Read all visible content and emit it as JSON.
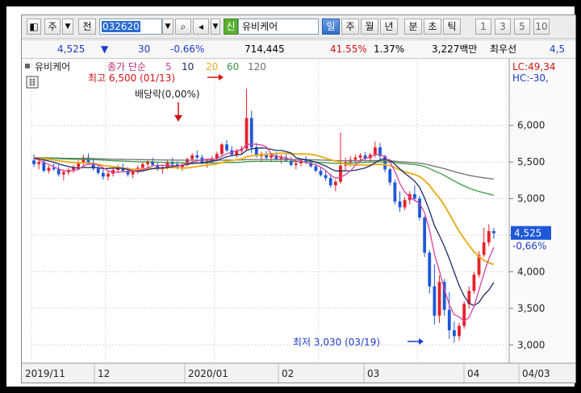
{
  "toolbar": {
    "btn_stock": "주",
    "btn_prev": "전",
    "code": "032620",
    "badge_new": "신",
    "stock_name": "유비케어",
    "periods": [
      "일",
      "주",
      "월",
      "년",
      "분",
      "초",
      "틱"
    ],
    "selected_period": "일",
    "intervals": [
      "1",
      "3",
      "5",
      "10"
    ]
  },
  "info": {
    "price": "4,525",
    "change": "30",
    "change_pct": "-0.66%",
    "volume": "714,445",
    "pct1": "41.55%",
    "pct2": "1.37%",
    "amount": "3,227백만",
    "pref_label": "최우선",
    "pref_value": "4,5"
  },
  "legend": {
    "name": "유비케어",
    "series_label": "종가 단순",
    "ma": [
      "5",
      "10",
      "20",
      "60",
      "120"
    ]
  },
  "colors": {
    "ma5": "#d8409e",
    "ma10": "#1e2a66",
    "ma20": "#e8b020",
    "ma60": "#3a9a44",
    "ma120": "#707070",
    "up": "#e8202a",
    "down": "#1e58d8"
  },
  "annotations": {
    "high": "최고 6,500 (01/13)",
    "dividend": "배당락(0,00%)",
    "low": "최저 3,030 (03/19)",
    "lc": "LC:49,34",
    "hc": "HC:-30,"
  },
  "chart_data": {
    "type": "candlestick",
    "yticks": [
      6000,
      5500,
      5000,
      4500,
      4000,
      3500,
      3000
    ],
    "ytick_labels": [
      "6,000",
      "5,500",
      "5,000",
      "4,500",
      "4,000",
      "3,500",
      "3,000"
    ],
    "ylim": [
      2750,
      6800
    ],
    "xlabels": [
      "2019/11",
      "12",
      "2020/01",
      "02",
      "03",
      "04",
      "04/03"
    ],
    "last_price_label": "4,525",
    "last_change_label": "-0,66%",
    "last_price": 4525,
    "high": 6500,
    "low": 3030,
    "ohlc": [
      [
        5520,
        5600,
        5430,
        5470
      ],
      [
        5470,
        5550,
        5400,
        5500
      ],
      [
        5500,
        5540,
        5360,
        5380
      ],
      [
        5380,
        5450,
        5340,
        5420
      ],
      [
        5420,
        5480,
        5380,
        5400
      ],
      [
        5400,
        5460,
        5300,
        5330
      ],
      [
        5330,
        5400,
        5250,
        5360
      ],
      [
        5360,
        5420,
        5320,
        5390
      ],
      [
        5390,
        5460,
        5350,
        5430
      ],
      [
        5430,
        5520,
        5400,
        5480
      ],
      [
        5480,
        5600,
        5450,
        5560
      ],
      [
        5560,
        5620,
        5460,
        5490
      ],
      [
        5490,
        5540,
        5380,
        5410
      ],
      [
        5410,
        5460,
        5330,
        5350
      ],
      [
        5350,
        5400,
        5260,
        5300
      ],
      [
        5300,
        5380,
        5250,
        5340
      ],
      [
        5340,
        5420,
        5300,
        5390
      ],
      [
        5390,
        5460,
        5350,
        5420
      ],
      [
        5420,
        5480,
        5360,
        5380
      ],
      [
        5380,
        5430,
        5300,
        5330
      ],
      [
        5330,
        5400,
        5280,
        5370
      ],
      [
        5370,
        5450,
        5340,
        5420
      ],
      [
        5420,
        5500,
        5390,
        5470
      ],
      [
        5470,
        5540,
        5420,
        5510
      ],
      [
        5510,
        5560,
        5440,
        5460
      ],
      [
        5460,
        5500,
        5380,
        5400
      ],
      [
        5400,
        5460,
        5340,
        5430
      ],
      [
        5430,
        5520,
        5400,
        5500
      ],
      [
        5500,
        5560,
        5440,
        5470
      ],
      [
        5470,
        5510,
        5400,
        5430
      ],
      [
        5430,
        5490,
        5380,
        5460
      ],
      [
        5460,
        5560,
        5440,
        5540
      ],
      [
        5540,
        5620,
        5500,
        5590
      ],
      [
        5590,
        5660,
        5540,
        5560
      ],
      [
        5560,
        5600,
        5470,
        5490
      ],
      [
        5490,
        5540,
        5420,
        5510
      ],
      [
        5510,
        5580,
        5480,
        5550
      ],
      [
        5550,
        5640,
        5520,
        5610
      ],
      [
        5610,
        5760,
        5580,
        5740
      ],
      [
        5740,
        5800,
        5640,
        5660
      ],
      [
        5660,
        5720,
        5580,
        5600
      ],
      [
        5600,
        5680,
        5560,
        5650
      ],
      [
        5650,
        5720,
        5600,
        5680
      ],
      [
        5680,
        6500,
        5660,
        6100
      ],
      [
        6100,
        6200,
        5620,
        5700
      ],
      [
        5700,
        5760,
        5560,
        5580
      ],
      [
        5580,
        5640,
        5500,
        5600
      ],
      [
        5600,
        5650,
        5520,
        5560
      ],
      [
        5560,
        5620,
        5500,
        5590
      ],
      [
        5590,
        5640,
        5520,
        5540
      ],
      [
        5540,
        5600,
        5480,
        5560
      ],
      [
        5560,
        5610,
        5500,
        5520
      ],
      [
        5520,
        5570,
        5440,
        5460
      ],
      [
        5460,
        5520,
        5400,
        5480
      ],
      [
        5480,
        5550,
        5440,
        5520
      ],
      [
        5520,
        5580,
        5470,
        5490
      ],
      [
        5490,
        5540,
        5420,
        5440
      ],
      [
        5440,
        5480,
        5360,
        5380
      ],
      [
        5380,
        5420,
        5300,
        5320
      ],
      [
        5320,
        5380,
        5240,
        5280
      ],
      [
        5280,
        5340,
        5150,
        5180
      ],
      [
        5180,
        5260,
        5100,
        5230
      ],
      [
        5230,
        5900,
        5200,
        5450
      ],
      [
        5450,
        5560,
        5380,
        5500
      ],
      [
        5500,
        5580,
        5440,
        5530
      ],
      [
        5530,
        5600,
        5480,
        5560
      ],
      [
        5560,
        5620,
        5500,
        5590
      ],
      [
        5590,
        5640,
        5520,
        5550
      ],
      [
        5550,
        5620,
        5500,
        5600
      ],
      [
        5600,
        5780,
        5560,
        5700
      ],
      [
        5700,
        5760,
        5540,
        5580
      ],
      [
        5580,
        5600,
        5360,
        5400
      ],
      [
        5400,
        5420,
        5180,
        5220
      ],
      [
        5220,
        5260,
        4920,
        4960
      ],
      [
        4960,
        5100,
        4820,
        4880
      ],
      [
        4880,
        5020,
        4840,
        4980
      ],
      [
        4980,
        5100,
        4920,
        5060
      ],
      [
        5060,
        5180,
        4960,
        5000
      ],
      [
        5000,
        5040,
        4700,
        4740
      ],
      [
        4740,
        4760,
        4200,
        4260
      ],
      [
        4260,
        4300,
        3700,
        3800
      ],
      [
        3800,
        4100,
        3280,
        3400
      ],
      [
        3400,
        3950,
        3300,
        3860
      ],
      [
        3860,
        3900,
        3400,
        3480
      ],
      [
        3480,
        3720,
        3080,
        3200
      ],
      [
        3200,
        3320,
        3030,
        3120
      ],
      [
        3120,
        3300,
        3060,
        3260
      ],
      [
        3260,
        3600,
        3220,
        3560
      ],
      [
        3560,
        3800,
        3500,
        3740
      ],
      [
        3740,
        4000,
        3700,
        3960
      ],
      [
        3960,
        4280,
        3920,
        4230
      ],
      [
        4230,
        4600,
        4200,
        4400
      ],
      [
        4400,
        4650,
        4350,
        4555
      ],
      [
        4555,
        4600,
        4450,
        4525
      ]
    ]
  }
}
